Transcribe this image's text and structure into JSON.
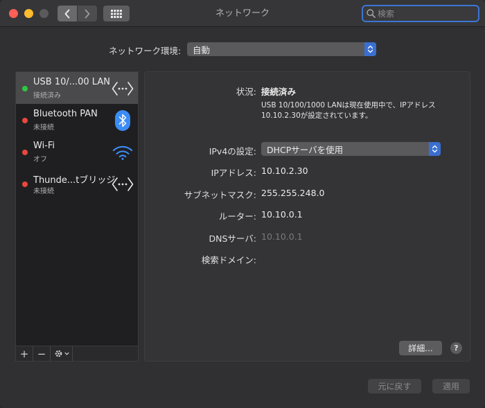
{
  "window": {
    "title": "ネットワーク"
  },
  "search": {
    "placeholder": "検索"
  },
  "location": {
    "label": "ネットワーク環境:",
    "value": "自動"
  },
  "services": [
    {
      "name": "USB 10/...00 LAN",
      "status": "接続済み",
      "status_color": "#2fc840",
      "icon": "ethernet-arrows-icon",
      "selected": true
    },
    {
      "name": "Bluetooth PAN",
      "status": "未接続",
      "status_color": "#e9473d",
      "icon": "bluetooth-icon",
      "selected": false
    },
    {
      "name": "Wi-Fi",
      "status": "オフ",
      "status_color": "#e9473d",
      "icon": "wifi-icon",
      "selected": false
    },
    {
      "name": "Thunde...tブリッジ",
      "status": "未接続",
      "status_color": "#e9473d",
      "icon": "ethernet-arrows-icon",
      "selected": false
    }
  ],
  "sidebar_tools": {
    "add": "+",
    "remove": "−"
  },
  "detail": {
    "status_label": "状況:",
    "status_value": "接続済み",
    "description": "USB 10/100/1000 LANは現在使用中で、IPアドレス10.10.2.30が設定されています。",
    "ipv4_label": "IPv4の設定:",
    "ipv4_value": "DHCPサーバを使用",
    "ip_label": "IPアドレス:",
    "ip_value": "10.10.2.30",
    "subnet_label": "サブネットマスク:",
    "subnet_value": "255.255.248.0",
    "router_label": "ルーター:",
    "router_value": "10.10.0.1",
    "dns_label": "DNSサーバ:",
    "dns_value": "10.10.0.1",
    "search_domain_label": "検索ドメイン:",
    "advanced_button": "詳細...",
    "help": "?"
  },
  "footer": {
    "revert_button": "元に戻す",
    "apply_button": "適用"
  },
  "colors": {
    "accent": "#3a6fd1",
    "connected": "#2fc840",
    "disconnected": "#e9473d",
    "bluetooth": "#3b8cf5",
    "wifi": "#3b8cf5"
  }
}
